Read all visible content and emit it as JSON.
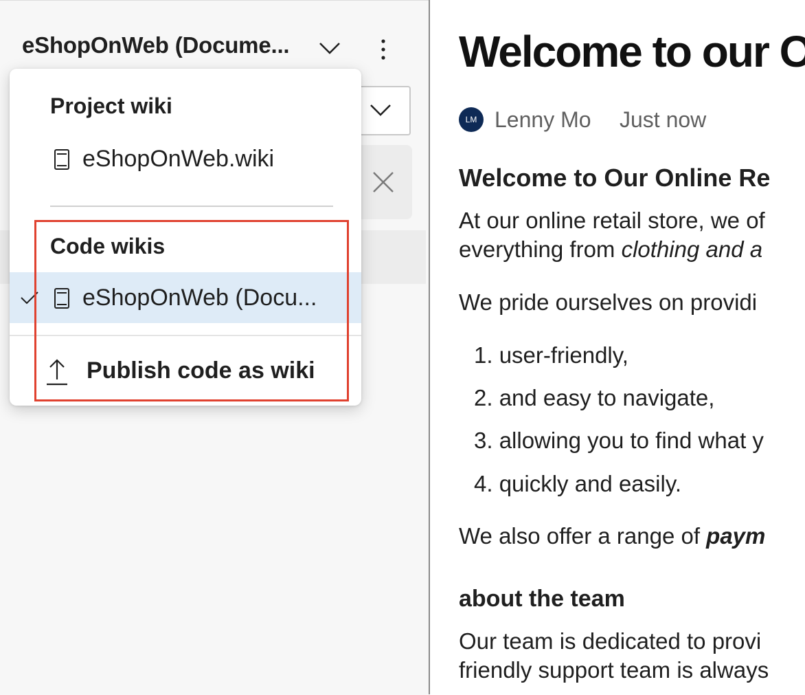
{
  "sidebar": {
    "wiki_selector_label": "eShopOnWeb (Docume...",
    "dropdown": {
      "project_group_title": "Project wiki",
      "project_items": [
        {
          "label": "eShopOnWeb.wiki",
          "icon": "book-icon"
        }
      ],
      "code_group_title": "Code wikis",
      "code_items": [
        {
          "label": "eShopOnWeb (Docu...",
          "icon": "book-icon",
          "selected": true
        }
      ],
      "publish_label": "Publish code as wiki",
      "publish_icon": "upload-icon"
    }
  },
  "article": {
    "title": "Welcome to our O",
    "author_initials": "LM",
    "author": "Lenny Mo",
    "timestamp": "Just now",
    "heading": "Welcome to Our Online Re",
    "para1_line1": "At our online retail store, we of",
    "para1_line2_prefix": "everything from ",
    "para1_line2_em": "clothing and a",
    "para2": "We pride ourselves on providi",
    "list": [
      "1. user-friendly,",
      "2. and easy to navigate,",
      "3. allowing you to find what y",
      "4. quickly and easily."
    ],
    "para3_prefix": "We also offer a range of ",
    "para3_strong": "paym",
    "subheading": "about the team",
    "para4_line1": "Our team is dedicated to provi",
    "para4_line2": "friendly support team is always"
  },
  "colors": {
    "highlight_border": "#e0412f",
    "selected_bg": "#deebf7",
    "avatar_bg": "#0e2a56"
  }
}
